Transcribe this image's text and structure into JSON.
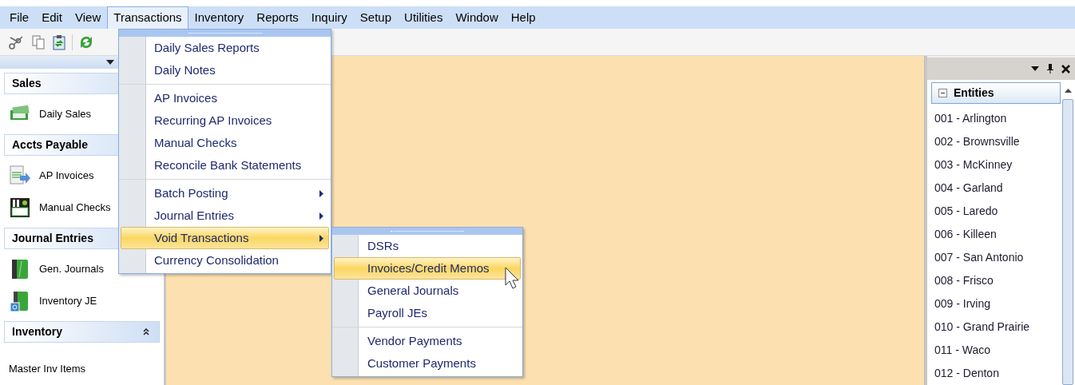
{
  "menu_bar": [
    {
      "label": "File",
      "selected": false
    },
    {
      "label": "Edit",
      "selected": false
    },
    {
      "label": "View",
      "selected": false
    },
    {
      "label": "Transactions",
      "selected": true
    },
    {
      "label": "Inventory",
      "selected": false
    },
    {
      "label": "Reports",
      "selected": false
    },
    {
      "label": "Inquiry",
      "selected": false
    },
    {
      "label": "Setup",
      "selected": false
    },
    {
      "label": "Utilities",
      "selected": false
    },
    {
      "label": "Window",
      "selected": false
    },
    {
      "label": "Help",
      "selected": false
    }
  ],
  "sidebar": [
    {
      "kind": "header",
      "label": "Sales"
    },
    {
      "kind": "icon_item",
      "label": "Daily Sales"
    },
    {
      "kind": "header",
      "label": "Accts Payable"
    },
    {
      "kind": "icon_item",
      "label": "AP Invoices"
    },
    {
      "kind": "icon_item",
      "label": "Manual Checks"
    },
    {
      "kind": "header",
      "label": "Journal Entries"
    },
    {
      "kind": "icon_item",
      "label": "Gen. Journals"
    },
    {
      "kind": "icon_item",
      "label": "Inventory JE"
    },
    {
      "kind": "header",
      "label": "Inventory",
      "collapsible": true
    },
    {
      "kind": "text_item",
      "label": "Master Inv Items"
    }
  ],
  "transactions_menu": [
    {
      "label": "Daily Sales Reports",
      "submenu": false,
      "selected": false
    },
    {
      "label": "Daily Notes",
      "submenu": false,
      "selected": false
    },
    {
      "label": "AP Invoices",
      "submenu": false,
      "selected": false,
      "separator_before": true
    },
    {
      "label": "Recurring AP Invoices",
      "submenu": false,
      "selected": false
    },
    {
      "label": "Manual Checks",
      "submenu": false,
      "selected": false
    },
    {
      "label": "Reconcile Bank Statements",
      "submenu": false,
      "selected": false
    },
    {
      "label": "Batch Posting",
      "submenu": true,
      "selected": false,
      "separator_before": true
    },
    {
      "label": "Journal Entries",
      "submenu": true,
      "selected": false
    },
    {
      "label": "Void Transactions",
      "submenu": true,
      "selected": true
    },
    {
      "label": "Currency Consolidation",
      "submenu": false,
      "selected": false
    }
  ],
  "void_submenu": [
    {
      "label": "DSRs",
      "selected": false
    },
    {
      "label": "Invoices/Credit Memos",
      "selected": true
    },
    {
      "label": "General Journals",
      "selected": false
    },
    {
      "label": "Payroll JEs",
      "selected": false
    },
    {
      "label": "Vendor Payments",
      "selected": false,
      "separator_before": true
    },
    {
      "label": "Customer Payments",
      "selected": false
    }
  ],
  "entities_panel": {
    "title": "Entities",
    "expanded": true,
    "items": [
      "001 - Arlington",
      "002 - Brownsville",
      "003 - McKinney",
      "004 - Garland",
      "005 - Laredo",
      "006 - Killeen",
      "007 - San Antonio",
      "008 - Frisco",
      "009 - Irving",
      "010 - Grand Prairie",
      "011 - Waco",
      "012 - Denton"
    ]
  }
}
